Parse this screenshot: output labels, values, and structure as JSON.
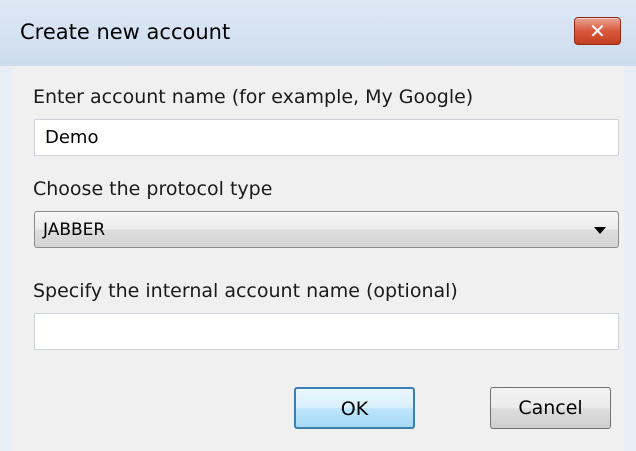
{
  "window": {
    "title": "Create new account",
    "close_icon": "close-icon",
    "close_glyph": "✕"
  },
  "account_name": {
    "label": "Enter account name (for example, My Google)",
    "value": "Demo"
  },
  "protocol": {
    "label": "Choose the protocol type",
    "selected": "JABBER",
    "arrow_icon": "chevron-down-icon"
  },
  "internal_name": {
    "label": "Specify the internal account name (optional)",
    "value": ""
  },
  "buttons": {
    "ok_label": "OK",
    "cancel_label": "Cancel"
  },
  "colors": {
    "close_button": "#d9583c",
    "ok_button_border": "#3c7fb1"
  }
}
